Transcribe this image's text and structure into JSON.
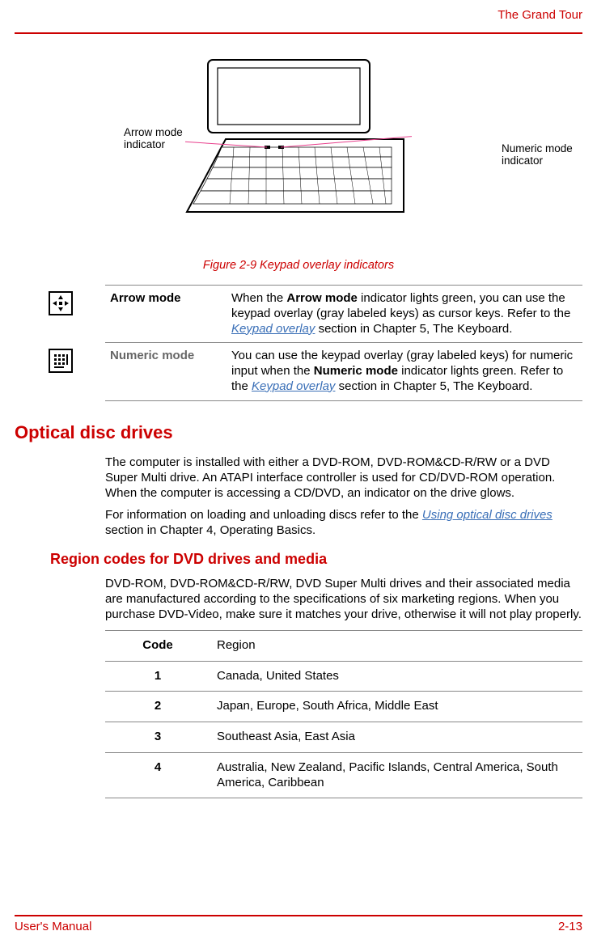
{
  "header": {
    "chapter": "The Grand Tour"
  },
  "figure": {
    "callout_left": "Arrow mode indicator",
    "callout_right": "Numeric mode indicator",
    "caption": "Figure 2-9 Keypad overlay indicators"
  },
  "definitions": {
    "arrow": {
      "label": "Arrow mode",
      "desc_prefix": "When the ",
      "desc_strong1": "Arrow mode",
      "desc_mid": " indicator lights green, you can use the keypad overlay (gray labeled keys) as cursor keys. Refer to the ",
      "link": "Keypad overlay",
      "desc_suffix": " section in Chapter 5, The Keyboard."
    },
    "numeric": {
      "label": "Numeric mode",
      "desc_prefix": "You can use the keypad overlay (gray labeled keys) for numeric input when the ",
      "desc_strong1": "Numeric mode",
      "desc_mid": " indicator lights green. Refer to the ",
      "link": "Keypad overlay",
      "desc_suffix": " section in Chapter 5, The Keyboard."
    }
  },
  "section": {
    "h1": "Optical disc drives",
    "p1": "The computer is installed with either a DVD-ROM, DVD-ROM&CD-R/RW or a DVD Super Multi drive. An ATAPI interface controller is used for CD/DVD-ROM operation. When the computer is accessing a CD/DVD, an indicator on the drive glows.",
    "p2_prefix": "For information on loading and unloading discs refer to the ",
    "p2_link": "Using optical disc drives",
    "p2_suffix": " section in Chapter 4, Operating Basics.",
    "h2": "Region codes for DVD drives and media",
    "p3": "DVD-ROM, DVD-ROM&CD-R/RW, DVD Super Multi drives and their associated media are manufactured according to the specifications of six marketing regions. When you purchase DVD-Video, make sure it matches your drive, otherwise it will not play properly."
  },
  "region_table": {
    "header_code": "Code",
    "header_region": "Region",
    "rows": [
      {
        "code": "1",
        "region": "Canada, United States"
      },
      {
        "code": "2",
        "region": "Japan, Europe, South Africa, Middle East"
      },
      {
        "code": "3",
        "region": "Southeast Asia, East Asia"
      },
      {
        "code": "4",
        "region": "Australia, New Zealand, Pacific Islands, Central America, South America, Caribbean"
      }
    ]
  },
  "footer": {
    "left": "User's Manual",
    "right": "2-13"
  }
}
